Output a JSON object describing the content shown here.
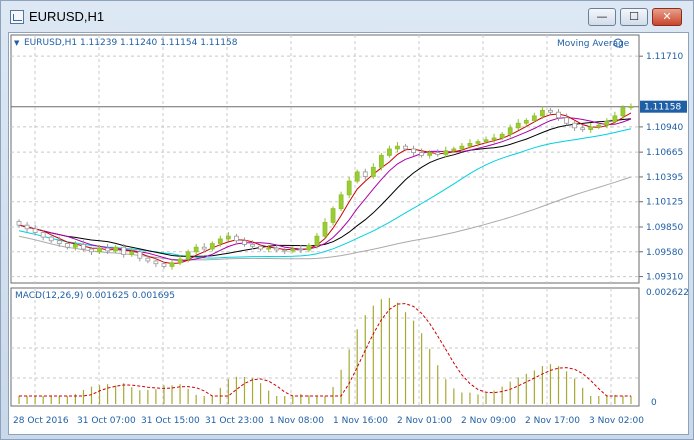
{
  "window": {
    "title": "EURUSD,H1",
    "controls": {
      "minimize": "—",
      "maximize": "☐",
      "close": "✕"
    }
  },
  "chart": {
    "header": "EURUSD,H1  1.11239 1.11240 1.11154 1.11158",
    "indicator_label": "Moving Average",
    "current_price": "1.11158",
    "price_ticks": [
      "1.11710",
      "1.10940",
      "1.10665",
      "1.10395",
      "1.10125",
      "1.09850",
      "1.09580",
      "1.09310"
    ],
    "price_tick_values": [
      1.1171,
      1.1094,
      1.10665,
      1.10395,
      1.10125,
      1.0985,
      1.0958,
      1.0931
    ],
    "time_ticks": [
      "28 Oct 2016",
      "31 Oct 07:00",
      "31 Oct 15:00",
      "31 Oct 23:00",
      "1 Nov 08:00",
      "1 Nov 16:00",
      "2 Nov 01:00",
      "2 Nov 09:00",
      "2 Nov 17:00",
      "3 Nov 02:00"
    ]
  },
  "macd": {
    "label": "MACD(12,26,9) 0.001625 0.001695",
    "ticks": [
      "0.002622",
      "0"
    ]
  },
  "colors": {
    "bull_candle": "#9acd32",
    "bear_candle": "#ffffff",
    "ma_fast": "#cc0000",
    "ma_mid": "#aa00aa",
    "ma_slow": "#000000",
    "ma_cyan": "#00d0e0",
    "ma_gray": "#aaaaaa",
    "grid": "#c8c8c8",
    "axis_text": "#1f5fa6",
    "macd_bar": "#a8a832",
    "macd_signal": "#cc0000"
  },
  "chart_data": {
    "type": "candlestick",
    "closes": [
      1.0987,
      1.0983,
      1.0979,
      1.0974,
      1.097,
      1.0967,
      1.0963,
      1.0966,
      1.0961,
      1.0958,
      1.0962,
      1.0959,
      1.0963,
      1.0955,
      1.0958,
      1.0951,
      1.0948,
      1.0945,
      1.0942,
      1.0946,
      1.095,
      1.0958,
      1.0963,
      1.0961,
      1.0967,
      1.0972,
      1.0975,
      1.097,
      1.0966,
      1.0964,
      1.0961,
      1.0962,
      1.096,
      1.0959,
      1.0961,
      1.096,
      1.0965,
      1.0975,
      1.099,
      1.1005,
      1.102,
      1.1035,
      1.1045,
      1.104,
      1.105,
      1.1063,
      1.107,
      1.1073,
      1.107,
      1.1066,
      1.1063,
      1.1066,
      1.1064,
      1.1068,
      1.107,
      1.1073,
      1.1076,
      1.1078,
      1.108,
      1.1082,
      1.1086,
      1.1093,
      1.1098,
      1.1101,
      1.1106,
      1.1112,
      1.111,
      1.1104,
      1.1098,
      1.1093,
      1.1091,
      1.1094,
      1.1096,
      1.11,
      1.1106,
      1.1115,
      1.1116
    ]
  }
}
